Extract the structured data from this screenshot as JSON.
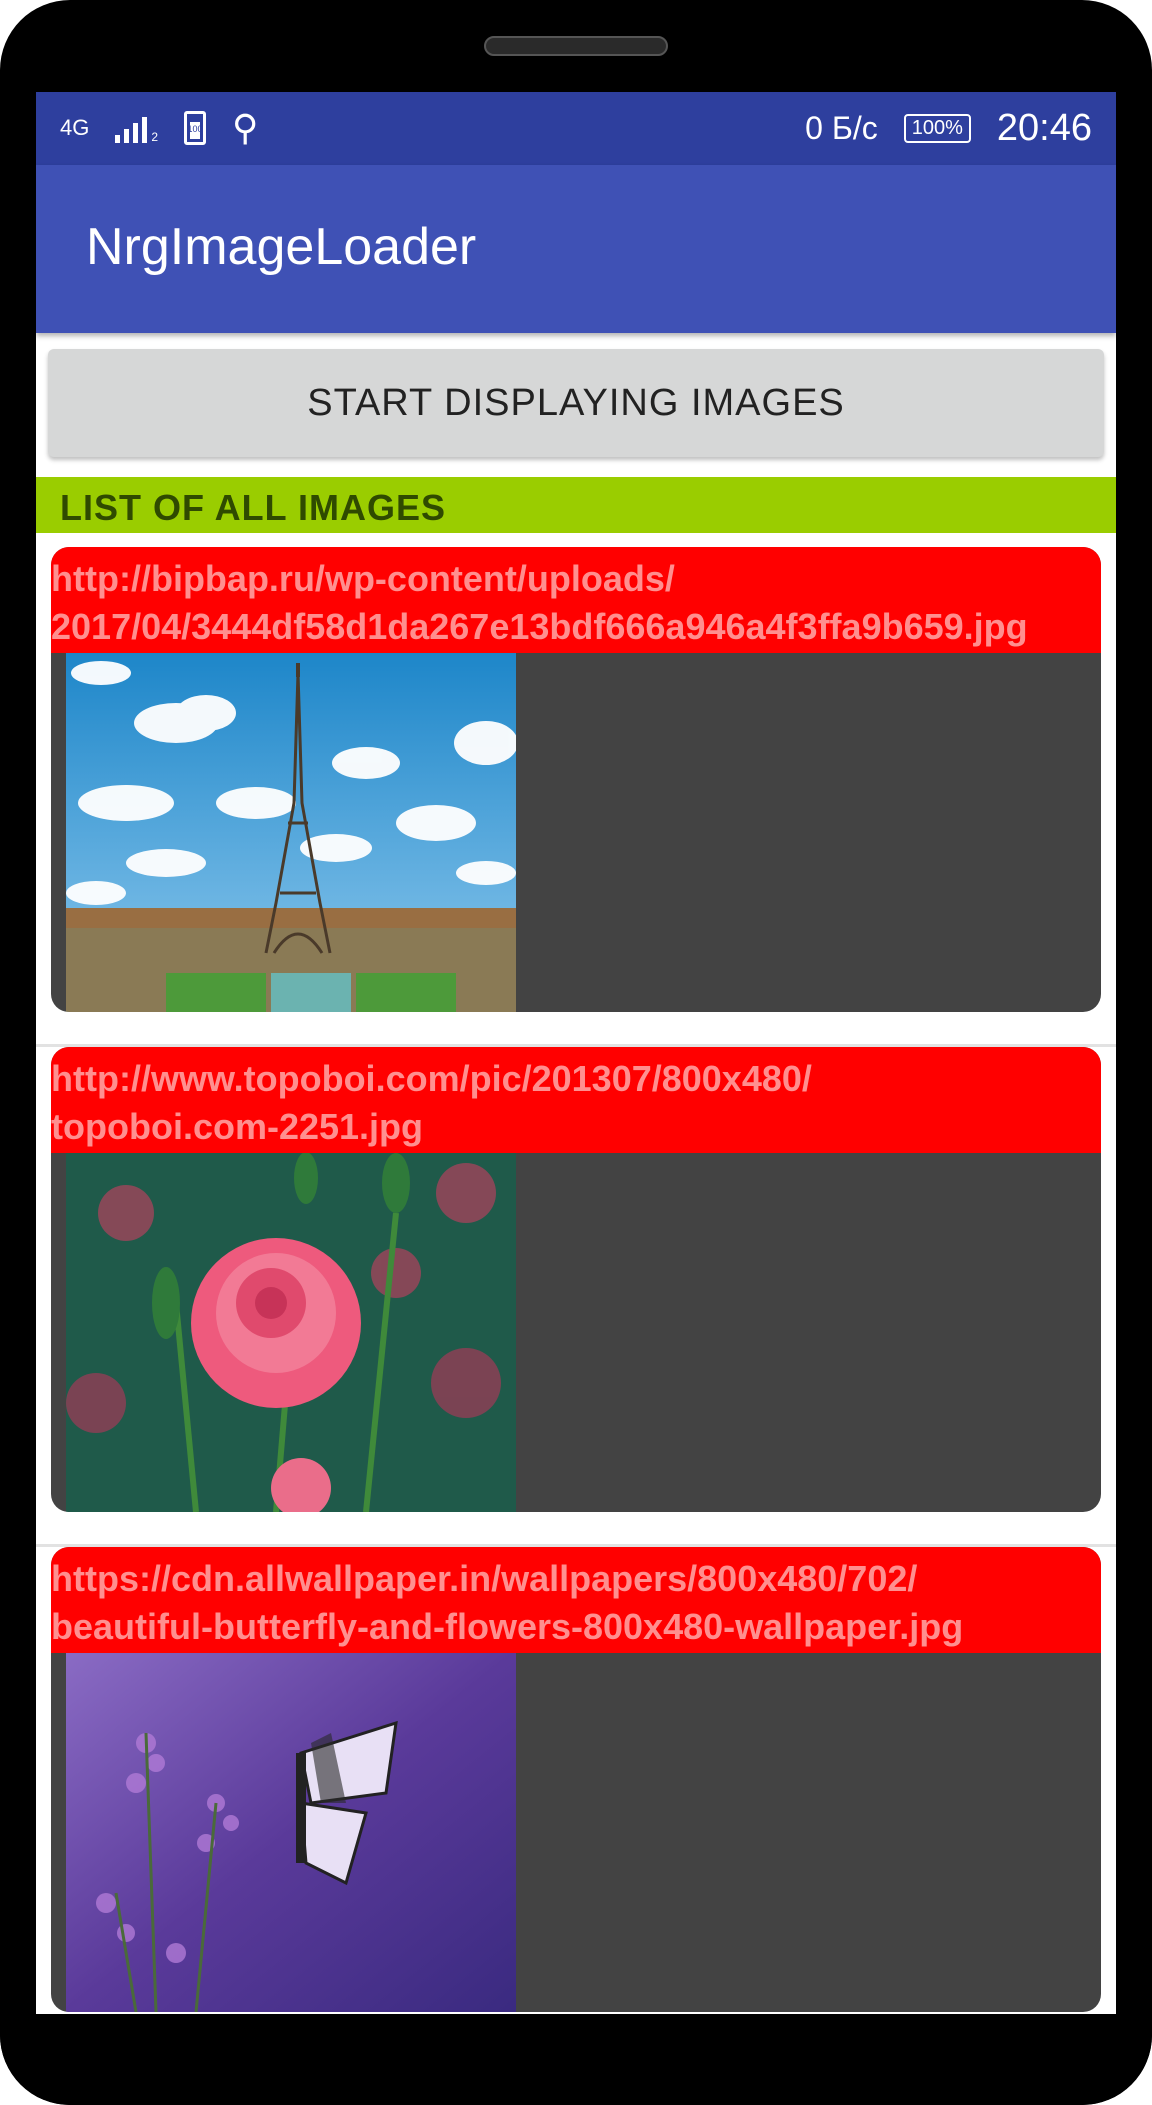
{
  "status_bar": {
    "network_type": "4G",
    "sim_label": "2",
    "battery_icon_level": "100",
    "net_speed": "0 Б/с",
    "battery_percent": "100%",
    "time": "20:46"
  },
  "app_bar": {
    "title": "NrgImageLoader"
  },
  "start_button": {
    "label": "START DISPLAYING IMAGES"
  },
  "list_header": {
    "label": "LIST OF ALL IMAGES"
  },
  "items": [
    {
      "url": "http://bipbap.ru/wp-content/uploads/\n2017/04/3444df58d1da267e13bdf666a946a4f3ffa9b659.jpg",
      "image": "eiffel-tower-photo"
    },
    {
      "url": "http://www.topoboi.com/pic/201307/800x480/\ntopoboi.com-2251.jpg",
      "image": "pink-rose-photo"
    },
    {
      "url": "https://cdn.allwallpaper.in/wallpapers/800x480/702/\nbeautiful-butterfly-and-flowers-800x480-wallpaper.jpg",
      "image": "butterfly-flowers-photo"
    }
  ],
  "colors": {
    "status_bar": "#2e3f9e",
    "app_bar": "#3f51b5",
    "list_header": "#9acd00",
    "url_background": "#ff0000",
    "url_text": "#ff8f8f",
    "card_background": "#434343"
  }
}
